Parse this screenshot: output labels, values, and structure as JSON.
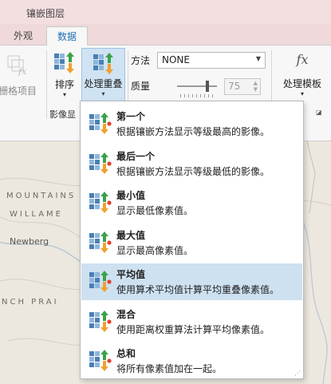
{
  "context_tab": {
    "title": "镶嵌图层"
  },
  "tabs": [
    {
      "label": "外观",
      "selected": false
    },
    {
      "label": "数据",
      "selected": true
    }
  ],
  "ribbon": {
    "raster_item_label": "栅格项目",
    "sort_label": "排序",
    "overlap_label": "处理重叠",
    "group_label": "影像显",
    "method_label": "方法",
    "method_value": "NONE",
    "quality_label": "质量",
    "quality_value": "75",
    "quality_fraction": 0.75,
    "template_label": "处理模板",
    "template_icon_text": "fx"
  },
  "map": {
    "labels": [
      "MOUNTAINS",
      "WILLAME",
      "Newberg",
      "NCH PRAI"
    ]
  },
  "menu": {
    "items": [
      {
        "title": "第一个",
        "desc": "根据镶嵌方法显示等级最高的影像。"
      },
      {
        "title": "最后一个",
        "desc": "根据镶嵌方法显示等级最低的影像。"
      },
      {
        "title": "最小值",
        "desc": "显示最低像素值。"
      },
      {
        "title": "最大值",
        "desc": "显示最高像素值。"
      },
      {
        "title": "平均值",
        "desc": "使用算术平均值计算平均重叠像素值。",
        "highlighted": true
      },
      {
        "title": "混合",
        "desc": "使用距离权重算法计算平均像素值。"
      },
      {
        "title": "总和",
        "desc": "将所有像素值加在一起。"
      }
    ]
  },
  "colors": {
    "accent": "#1f6fb5",
    "highlight": "#cde1f1",
    "arrow_green": "#3aa14a",
    "arrow_orange": "#f0a030",
    "dot_red": "#e0402f"
  }
}
